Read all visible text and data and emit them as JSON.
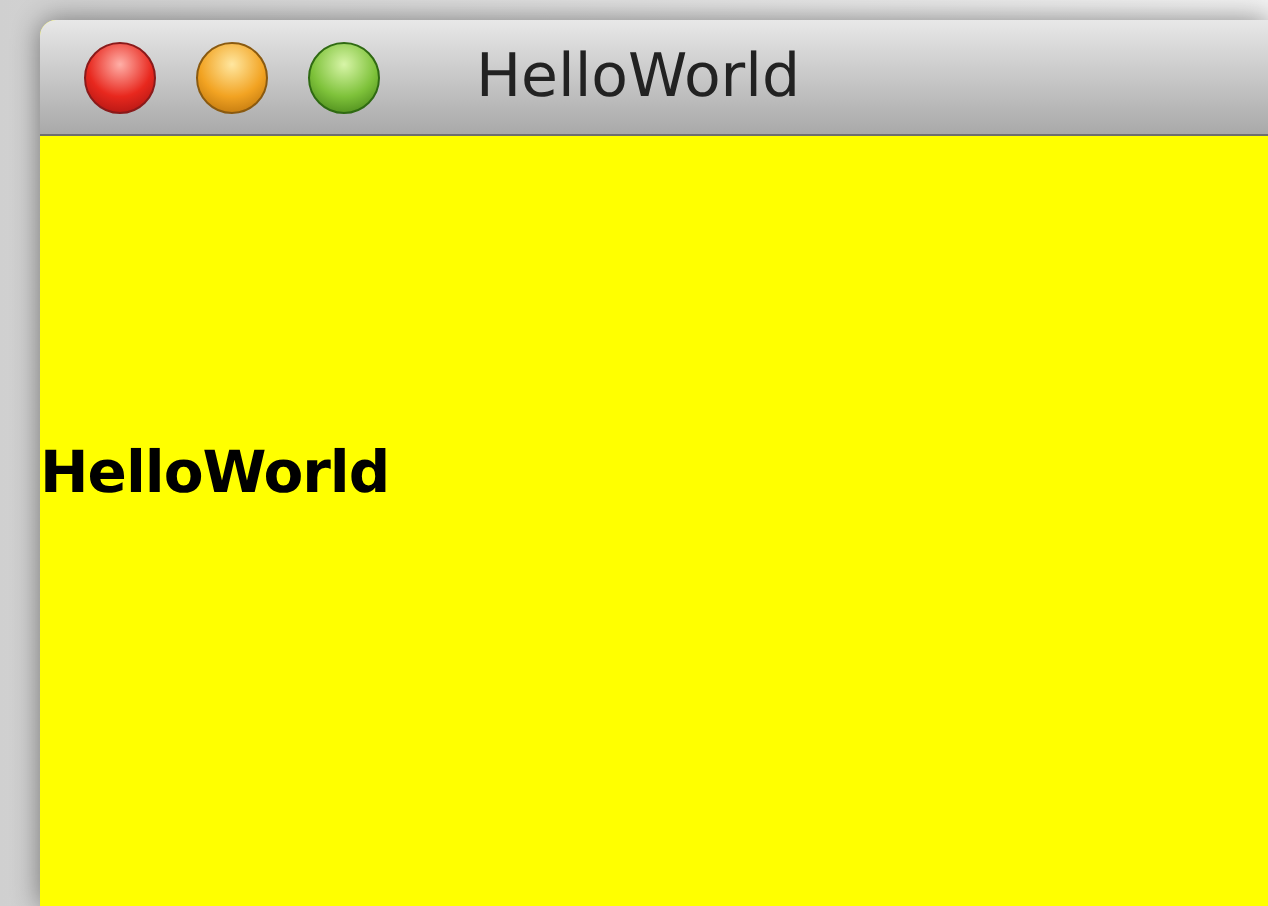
{
  "window": {
    "title": "HelloWorld"
  },
  "content": {
    "label": "HelloWorld"
  }
}
